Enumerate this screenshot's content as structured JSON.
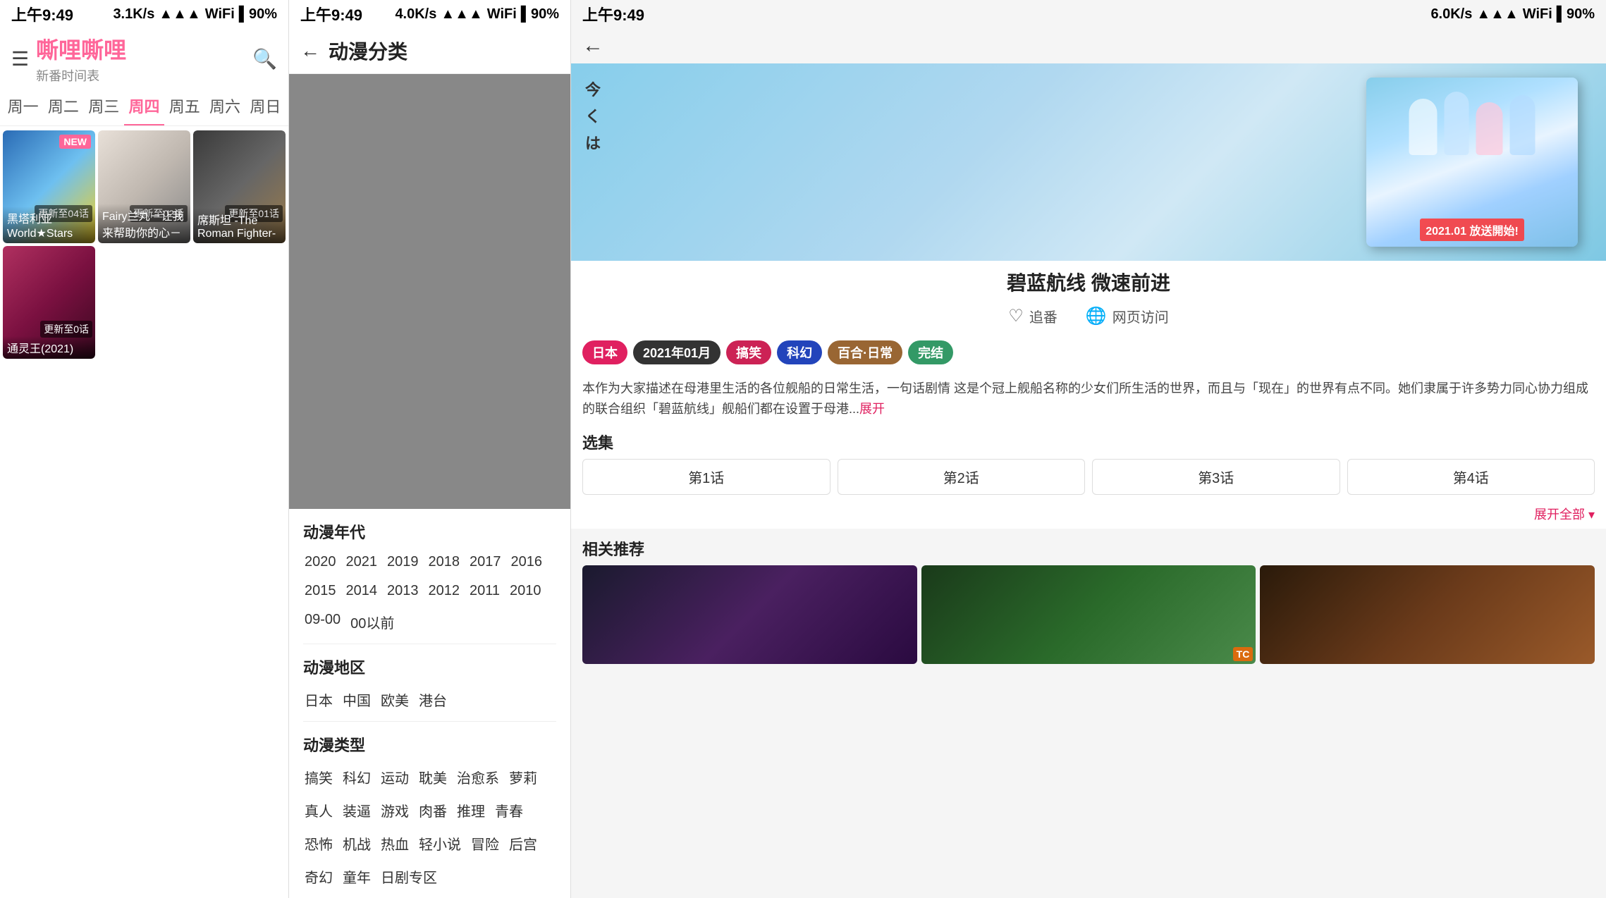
{
  "panel1": {
    "status": {
      "time": "上午9:49",
      "network": "3.1K/s",
      "signal": "📶",
      "wifi": "🛜",
      "battery": "🔋 90%"
    },
    "logo": "嘶哩嘶哩",
    "subtitle": "新番时间表",
    "search_icon": "🔍",
    "menu_icon": "☰",
    "weekdays": [
      "周一",
      "周二",
      "周三",
      "周四",
      "周五",
      "周六",
      "周日"
    ],
    "active_day_index": 3,
    "animes": [
      {
        "title": "黑塔利亚 World★Stars",
        "episode": "更新至04话",
        "is_new": true,
        "thumb_class": "thumb-1"
      },
      {
        "title": "Fairy兰丸－让我来帮助你的心－",
        "episode": "更新至02话",
        "is_new": false,
        "thumb_class": "thumb-2"
      },
      {
        "title": "席斯坦 -The Roman Fighter-",
        "episode": "更新至01话",
        "is_new": false,
        "thumb_class": "thumb-3"
      },
      {
        "title": "通灵王(2021)",
        "episode": "更新至0话",
        "is_new": false,
        "thumb_class": "thumb-4"
      }
    ]
  },
  "panel2": {
    "status": {
      "time": "上午9:49",
      "network": "4.0K/s",
      "signal": "📶",
      "wifi": "🛜",
      "battery": "🔋 90%"
    },
    "title": "动漫分类",
    "back_label": "←",
    "sections": [
      {
        "title": "动漫年代",
        "tags": [
          "2020",
          "2021",
          "2019",
          "2018",
          "2017",
          "2016",
          "2015",
          "2014",
          "2013",
          "2012",
          "2011",
          "2010",
          "09-00",
          "00以前"
        ]
      },
      {
        "title": "动漫地区",
        "tags": [
          "日本",
          "中国",
          "欧美",
          "港台"
        ]
      },
      {
        "title": "动漫类型",
        "tags": [
          "搞笑",
          "科幻",
          "运动",
          "耽美",
          "治愈系",
          "萝莉",
          "真人",
          "装逼",
          "游戏",
          "肉番",
          "推理",
          "青春",
          "恐怖",
          "机战",
          "热血",
          "轻小说",
          "冒险",
          "后宫",
          "奇幻",
          "童年",
          "日剧专区"
        ]
      }
    ]
  },
  "panel3": {
    "status": {
      "time": "上午9:49",
      "network": "6.0K/s",
      "signal": "📶",
      "wifi": "🛜",
      "battery": "🔋 90%"
    },
    "sidebar_chars": [
      "今",
      "く",
      "は"
    ],
    "anime_name": "碧蓝航线 微速前进",
    "poster_label": "2021.01 放送開始!",
    "actions": [
      {
        "icon": "♡",
        "label": "追番"
      },
      {
        "icon": "🌐",
        "label": "网页访问"
      }
    ],
    "tags": [
      "日本",
      "2021年01月",
      "搞笑",
      "科幻",
      "百合·日常",
      "完结"
    ],
    "description": "本作为大家描述在母港里生活的各位舰船的日常生活，一句话剧情 这是个冠上舰船名称的少女们所生活的世界，而且与「现在」的世界有点不同。她们隶属于许多势力同心协力组成的联合组织「碧蓝航线」舰船们都在设置于母港...",
    "expand_label": "展开",
    "episodes_title": "选集",
    "episodes": [
      "第1话",
      "第2话",
      "第3话",
      "第4话"
    ],
    "expand_all_label": "展开全部 ▾",
    "related_title": "相关推荐",
    "related_items": [
      {
        "thumb_class": "related-thumb-1"
      },
      {
        "thumb_class": "related-thumb-2",
        "watermark": "TC"
      },
      {
        "thumb_class": "related-thumb-3"
      }
    ]
  }
}
